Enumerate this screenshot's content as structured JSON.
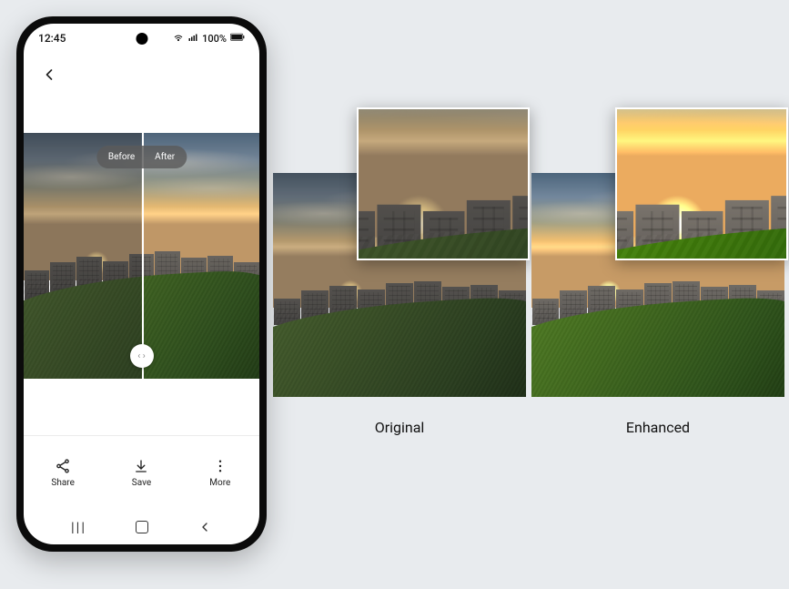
{
  "status": {
    "time": "12:45",
    "battery_text": "100%",
    "wifi_icon": "wifi-icon",
    "signal_icon": "signal-icon",
    "battery_icon": "battery-icon"
  },
  "editor": {
    "back_icon": "chevron-left-icon",
    "slider": {
      "before_label": "Before",
      "after_label": "After",
      "position_percent": 50
    }
  },
  "toolbar": {
    "share": {
      "label": "Share",
      "icon": "share-icon"
    },
    "save": {
      "label": "Save",
      "icon": "download-icon"
    },
    "more": {
      "label": "More",
      "icon": "more-vertical-icon"
    }
  },
  "nav": {
    "recents_icon": "recents-icon",
    "home_icon": "home-icon",
    "back_icon": "back-nav-icon"
  },
  "comparison": {
    "original_label": "Original",
    "enhanced_label": "Enhanced"
  }
}
